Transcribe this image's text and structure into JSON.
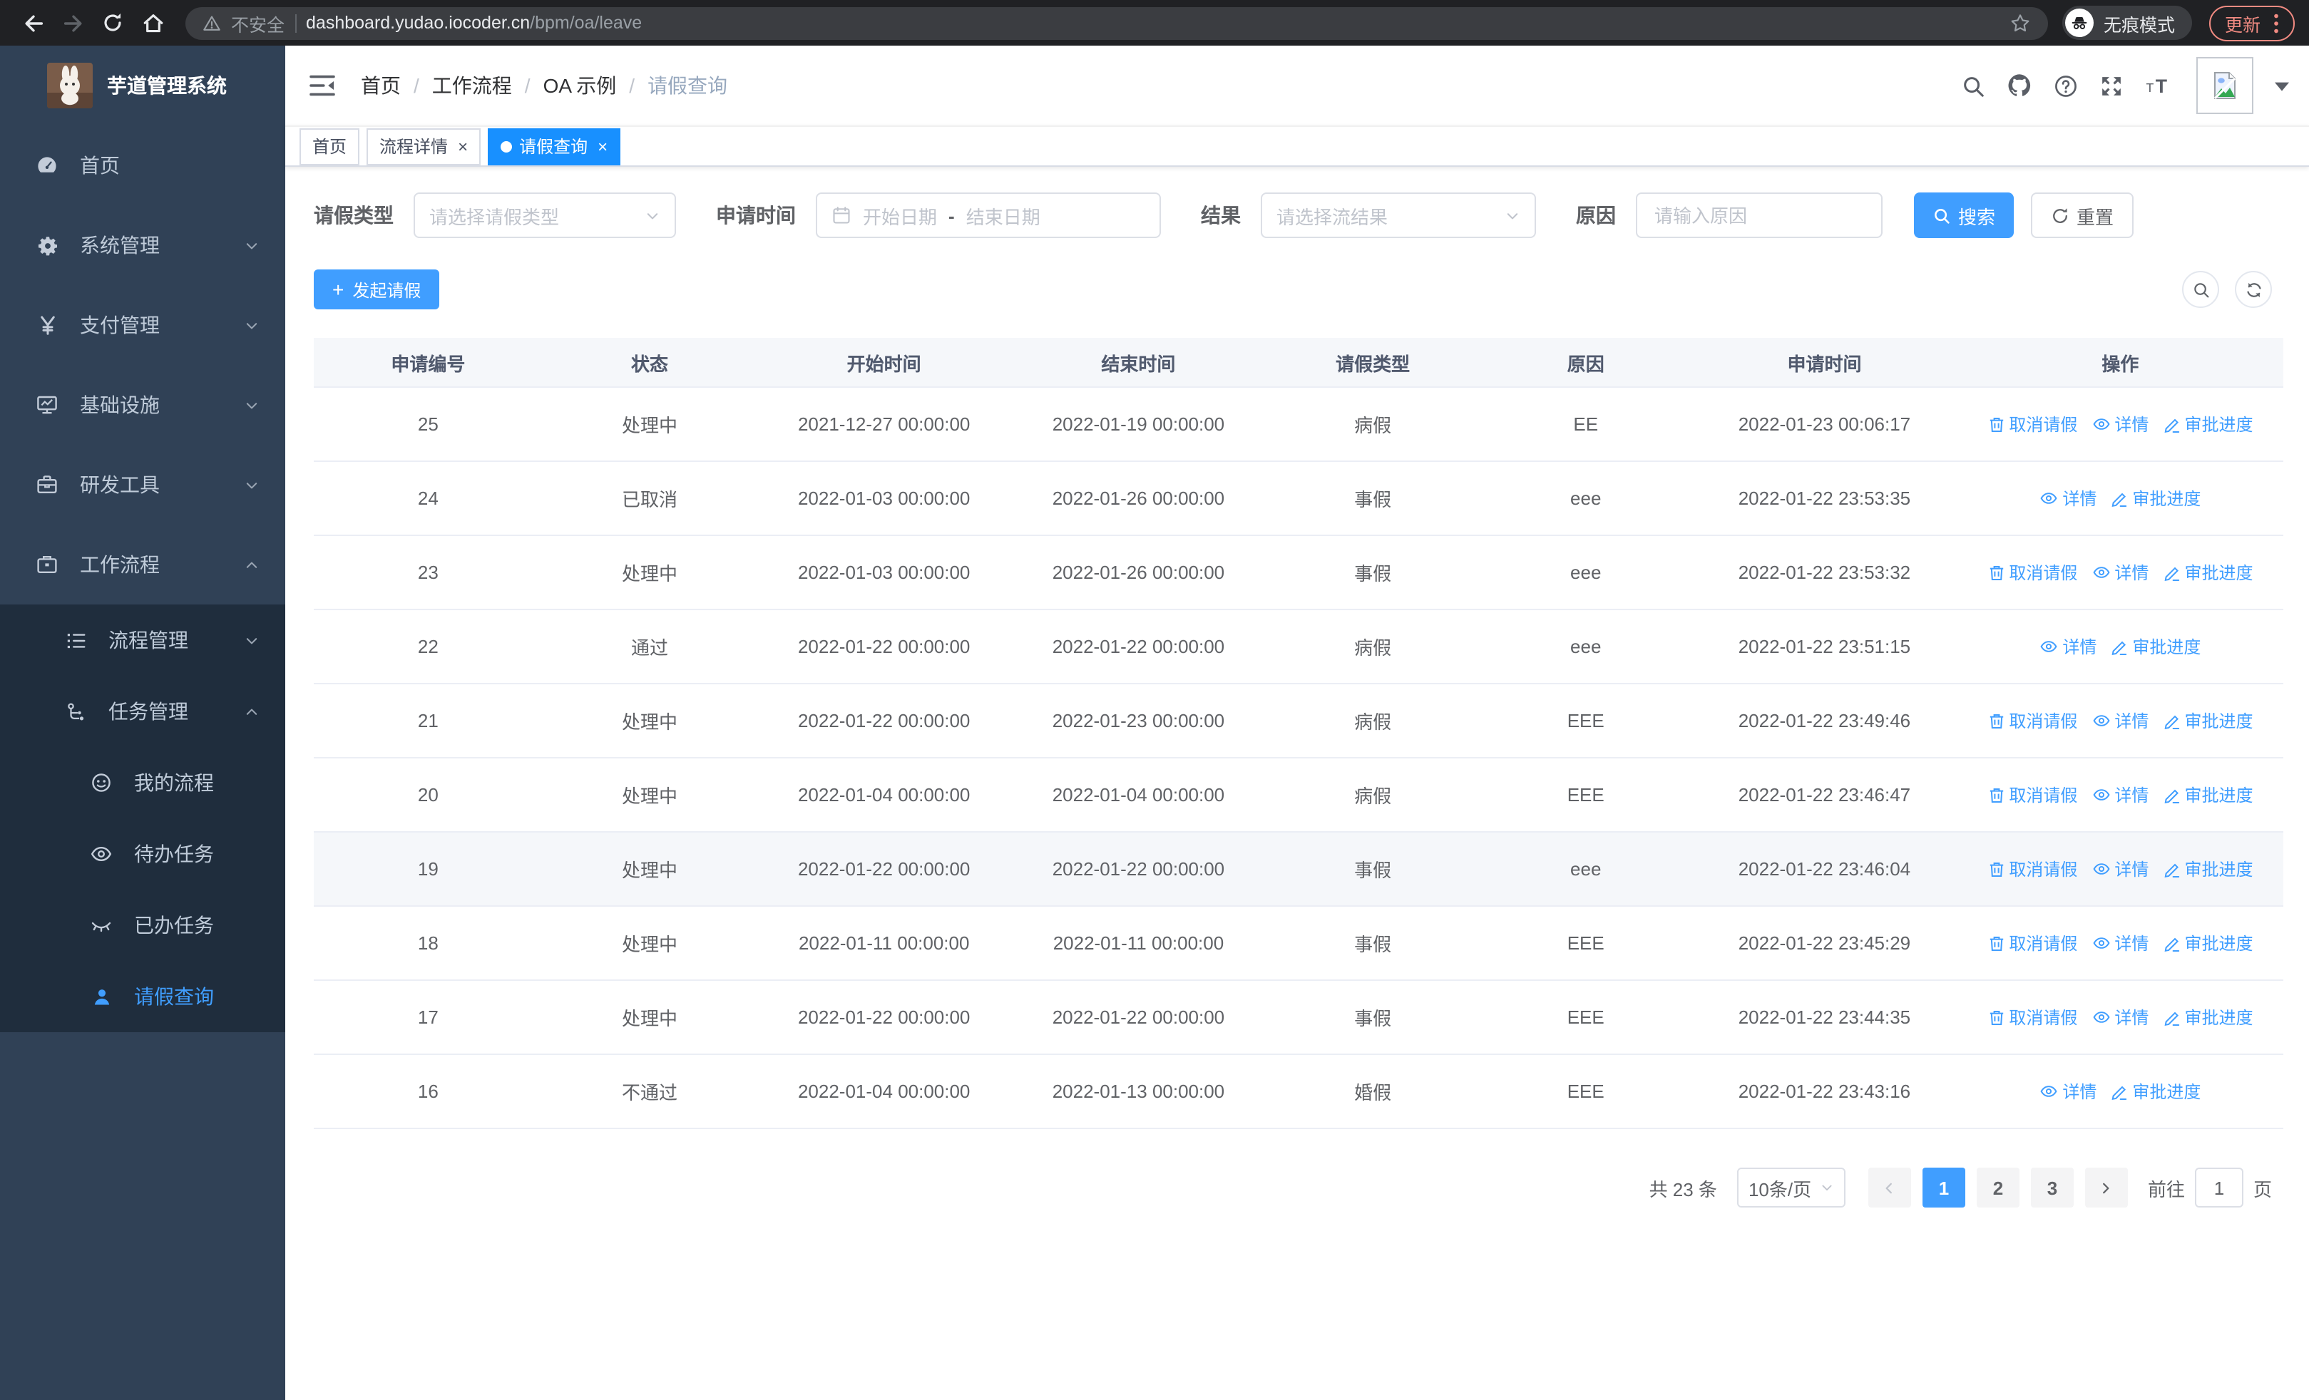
{
  "browser": {
    "security_label": "不安全",
    "url_host": "dashboard.yudao.iocoder.cn",
    "url_path": "/bpm/oa/leave",
    "incognito_label": "无痕模式",
    "update_label": "更新"
  },
  "colors": {
    "accent": "#409eff",
    "tag_active": "#1890ff",
    "sidebar_bg": "#304156",
    "submenu_bg": "#1f2d3d",
    "update_coral": "#f28b82"
  },
  "ui": {
    "close_glyph": "×",
    "plus_glyph": "+",
    "breadcrumb_separator": "/"
  },
  "sidebar": {
    "title": "芋道管理系统",
    "items": [
      {
        "label": "首页",
        "icon": "dashboard-icon",
        "level": 1,
        "sub": false,
        "expand": null,
        "active": false
      },
      {
        "label": "系统管理",
        "icon": "gear-icon",
        "level": 1,
        "sub": false,
        "expand": "down",
        "active": false
      },
      {
        "label": "支付管理",
        "icon": "yen-icon",
        "level": 1,
        "sub": false,
        "expand": "down",
        "active": false
      },
      {
        "label": "基础设施",
        "icon": "monitor-icon",
        "level": 1,
        "sub": false,
        "expand": "down",
        "active": false
      },
      {
        "label": "研发工具",
        "icon": "toolbox-icon",
        "level": 1,
        "sub": false,
        "expand": "down",
        "active": false
      },
      {
        "label": "工作流程",
        "icon": "briefcase-icon",
        "level": 1,
        "sub": false,
        "expand": "up",
        "active": false
      },
      {
        "label": "流程管理",
        "icon": "list-icon",
        "level": 2,
        "sub": true,
        "expand": "down",
        "active": false
      },
      {
        "label": "任务管理",
        "icon": "flow-icon",
        "level": 2,
        "sub": true,
        "expand": "up",
        "active": false
      },
      {
        "label": "我的流程",
        "icon": "face-icon",
        "level": 3,
        "sub": true,
        "expand": null,
        "active": false
      },
      {
        "label": "待办任务",
        "icon": "eye-icon",
        "level": 3,
        "sub": true,
        "expand": null,
        "active": false
      },
      {
        "label": "已办任务",
        "icon": "eye-closed-icon",
        "level": 3,
        "sub": true,
        "expand": null,
        "active": false
      },
      {
        "label": "请假查询",
        "icon": "user-icon",
        "level": 3,
        "sub": true,
        "expand": null,
        "active": true
      }
    ]
  },
  "header": {
    "breadcrumb": [
      "首页",
      "工作流程",
      "OA 示例",
      "请假查询"
    ]
  },
  "tags": [
    {
      "label": "首页",
      "closable": false,
      "active": false
    },
    {
      "label": "流程详情",
      "closable": true,
      "active": false
    },
    {
      "label": "请假查询",
      "closable": true,
      "active": true
    }
  ],
  "filters": {
    "leave_type_label": "请假类型",
    "leave_type_placeholder": "请选择请假类型",
    "apply_time_label": "申请时间",
    "start_placeholder": "开始日期",
    "range_separator": "-",
    "end_placeholder": "结束日期",
    "result_label": "结果",
    "result_placeholder": "请选择流结果",
    "reason_label": "原因",
    "reason_placeholder": "请输入原因",
    "search_label": "搜索",
    "reset_label": "重置"
  },
  "toolbar": {
    "create_label": "发起请假"
  },
  "table": {
    "columns": [
      "申请编号",
      "状态",
      "开始时间",
      "结束时间",
      "请假类型",
      "原因",
      "申请时间",
      "操作"
    ],
    "action_labels": {
      "cancel": "取消请假",
      "detail": "详情",
      "progress": "审批进度"
    },
    "action_icons": {
      "cancel": "trash-icon",
      "detail": "view-icon",
      "progress": "edit-icon"
    },
    "rows": [
      {
        "id": "25",
        "status": "处理中",
        "start": "2021-12-27 00:00:00",
        "end": "2022-01-19 00:00:00",
        "type": "病假",
        "reason": "EE",
        "applied": "2022-01-23 00:06:17",
        "cancel": true,
        "hover": false
      },
      {
        "id": "24",
        "status": "已取消",
        "start": "2022-01-03 00:00:00",
        "end": "2022-01-26 00:00:00",
        "type": "事假",
        "reason": "eee",
        "applied": "2022-01-22 23:53:35",
        "cancel": false,
        "hover": false
      },
      {
        "id": "23",
        "status": "处理中",
        "start": "2022-01-03 00:00:00",
        "end": "2022-01-26 00:00:00",
        "type": "事假",
        "reason": "eee",
        "applied": "2022-01-22 23:53:32",
        "cancel": true,
        "hover": false
      },
      {
        "id": "22",
        "status": "通过",
        "start": "2022-01-22 00:00:00",
        "end": "2022-01-22 00:00:00",
        "type": "病假",
        "reason": "eee",
        "applied": "2022-01-22 23:51:15",
        "cancel": false,
        "hover": false
      },
      {
        "id": "21",
        "status": "处理中",
        "start": "2022-01-22 00:00:00",
        "end": "2022-01-23 00:00:00",
        "type": "病假",
        "reason": "EEE",
        "applied": "2022-01-22 23:49:46",
        "cancel": true,
        "hover": false
      },
      {
        "id": "20",
        "status": "处理中",
        "start": "2022-01-04 00:00:00",
        "end": "2022-01-04 00:00:00",
        "type": "病假",
        "reason": "EEE",
        "applied": "2022-01-22 23:46:47",
        "cancel": true,
        "hover": false
      },
      {
        "id": "19",
        "status": "处理中",
        "start": "2022-01-22 00:00:00",
        "end": "2022-01-22 00:00:00",
        "type": "事假",
        "reason": "eee",
        "applied": "2022-01-22 23:46:04",
        "cancel": true,
        "hover": true
      },
      {
        "id": "18",
        "status": "处理中",
        "start": "2022-01-11 00:00:00",
        "end": "2022-01-11 00:00:00",
        "type": "事假",
        "reason": "EEE",
        "applied": "2022-01-22 23:45:29",
        "cancel": true,
        "hover": false
      },
      {
        "id": "17",
        "status": "处理中",
        "start": "2022-01-22 00:00:00",
        "end": "2022-01-22 00:00:00",
        "type": "事假",
        "reason": "EEE",
        "applied": "2022-01-22 23:44:35",
        "cancel": true,
        "hover": false
      },
      {
        "id": "16",
        "status": "不通过",
        "start": "2022-01-04 00:00:00",
        "end": "2022-01-13 00:00:00",
        "type": "婚假",
        "reason": "EEE",
        "applied": "2022-01-22 23:43:16",
        "cancel": false,
        "hover": false
      }
    ]
  },
  "pagination": {
    "total": "共 23 条",
    "page_size": "10条/页",
    "pages": [
      "1",
      "2",
      "3"
    ],
    "active": "1",
    "goto_label": "前往",
    "goto_value": "1",
    "unit": "页"
  }
}
